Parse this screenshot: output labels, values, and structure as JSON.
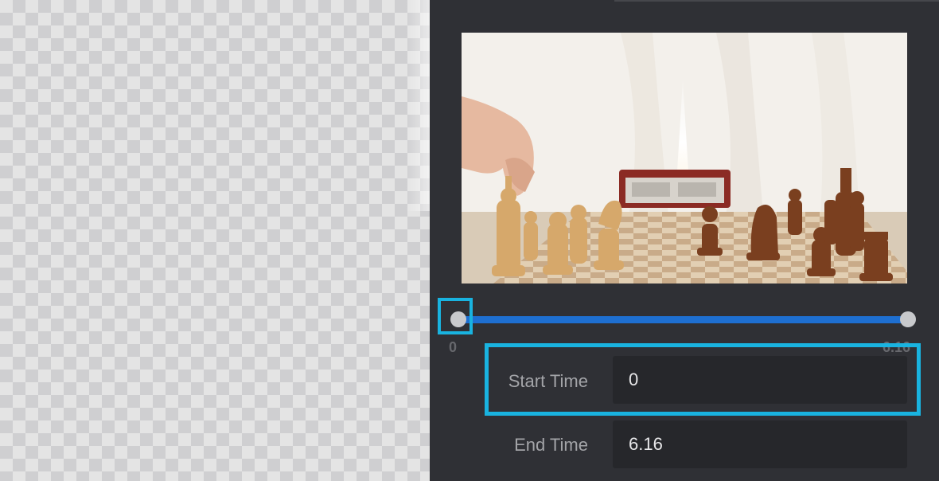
{
  "slider": {
    "min_label": "0",
    "max_label": "6.16",
    "start_value": 0,
    "end_value": 6.16,
    "track_color": "#1e6fd1"
  },
  "fields": {
    "start_time": {
      "label": "Start Time",
      "value": "0"
    },
    "end_time": {
      "label": "End Time",
      "value": "6.16"
    }
  },
  "highlight_color": "#19b3e0"
}
